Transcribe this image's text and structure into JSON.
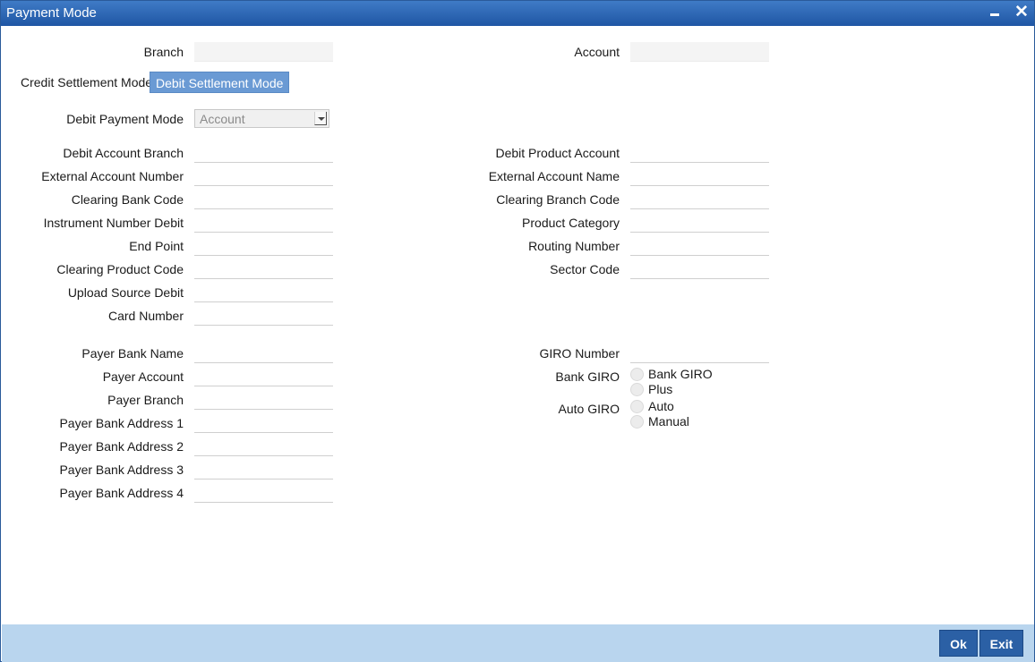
{
  "window": {
    "title": "Payment Mode"
  },
  "header": {
    "branch_label": "Branch",
    "account_label": "Account"
  },
  "tabs": [
    {
      "label": "Credit Settlement Mode",
      "active": false
    },
    {
      "label": "Debit Settlement Mode",
      "active": true
    }
  ],
  "debit_payment_mode": {
    "label": "Debit Payment Mode",
    "value": "Account"
  },
  "left_fields": [
    {
      "label": "Debit Account Branch",
      "value": ""
    },
    {
      "label": "External Account Number",
      "value": ""
    },
    {
      "label": "Clearing Bank Code",
      "value": ""
    },
    {
      "label": "Instrument Number Debit",
      "value": ""
    },
    {
      "label": "End Point",
      "value": ""
    },
    {
      "label": "Clearing Product Code",
      "value": ""
    },
    {
      "label": "Upload Source Debit",
      "value": ""
    },
    {
      "label": "Card Number",
      "value": ""
    }
  ],
  "right_fields": [
    {
      "label": "Debit Product Account",
      "value": ""
    },
    {
      "label": "External Account Name",
      "value": ""
    },
    {
      "label": "Clearing Branch Code",
      "value": ""
    },
    {
      "label": "Product Category",
      "value": ""
    },
    {
      "label": "Routing Number",
      "value": ""
    },
    {
      "label": "Sector Code",
      "value": ""
    }
  ],
  "payer_fields": [
    {
      "label": "Payer Bank Name",
      "value": ""
    },
    {
      "label": "Payer Account",
      "value": ""
    },
    {
      "label": "Payer Branch",
      "value": ""
    },
    {
      "label": "Payer Bank Address 1",
      "value": ""
    },
    {
      "label": "Payer Bank Address 2",
      "value": ""
    },
    {
      "label": "Payer Bank Address 3",
      "value": ""
    },
    {
      "label": "Payer Bank Address 4",
      "value": ""
    }
  ],
  "giro": {
    "giro_number_label": "GIRO Number",
    "bank_giro_label": "Bank GIRO",
    "bank_giro_options": [
      "Bank GIRO",
      "Plus"
    ],
    "auto_giro_label": "Auto GIRO",
    "auto_giro_options": [
      "Auto",
      "Manual"
    ]
  },
  "footer": {
    "ok_label": "Ok",
    "exit_label": "Exit"
  }
}
